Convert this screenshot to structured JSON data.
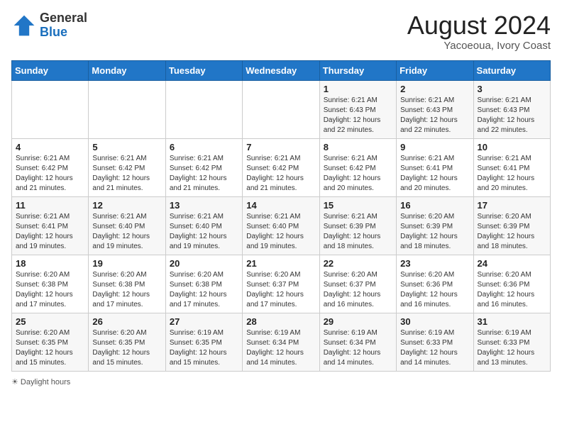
{
  "logo": {
    "general": "General",
    "blue": "Blue"
  },
  "title": {
    "month_year": "August 2024",
    "location": "Yacoeoua, Ivory Coast"
  },
  "days_of_week": [
    "Sunday",
    "Monday",
    "Tuesday",
    "Wednesday",
    "Thursday",
    "Friday",
    "Saturday"
  ],
  "legend": {
    "label": "Daylight hours"
  },
  "weeks": [
    [
      {
        "day": "",
        "info": ""
      },
      {
        "day": "",
        "info": ""
      },
      {
        "day": "",
        "info": ""
      },
      {
        "day": "",
        "info": ""
      },
      {
        "day": "1",
        "info": "Sunrise: 6:21 AM\nSunset: 6:43 PM\nDaylight: 12 hours\nand 22 minutes."
      },
      {
        "day": "2",
        "info": "Sunrise: 6:21 AM\nSunset: 6:43 PM\nDaylight: 12 hours\nand 22 minutes."
      },
      {
        "day": "3",
        "info": "Sunrise: 6:21 AM\nSunset: 6:43 PM\nDaylight: 12 hours\nand 22 minutes."
      }
    ],
    [
      {
        "day": "4",
        "info": "Sunrise: 6:21 AM\nSunset: 6:42 PM\nDaylight: 12 hours\nand 21 minutes."
      },
      {
        "day": "5",
        "info": "Sunrise: 6:21 AM\nSunset: 6:42 PM\nDaylight: 12 hours\nand 21 minutes."
      },
      {
        "day": "6",
        "info": "Sunrise: 6:21 AM\nSunset: 6:42 PM\nDaylight: 12 hours\nand 21 minutes."
      },
      {
        "day": "7",
        "info": "Sunrise: 6:21 AM\nSunset: 6:42 PM\nDaylight: 12 hours\nand 21 minutes."
      },
      {
        "day": "8",
        "info": "Sunrise: 6:21 AM\nSunset: 6:42 PM\nDaylight: 12 hours\nand 20 minutes."
      },
      {
        "day": "9",
        "info": "Sunrise: 6:21 AM\nSunset: 6:41 PM\nDaylight: 12 hours\nand 20 minutes."
      },
      {
        "day": "10",
        "info": "Sunrise: 6:21 AM\nSunset: 6:41 PM\nDaylight: 12 hours\nand 20 minutes."
      }
    ],
    [
      {
        "day": "11",
        "info": "Sunrise: 6:21 AM\nSunset: 6:41 PM\nDaylight: 12 hours\nand 19 minutes."
      },
      {
        "day": "12",
        "info": "Sunrise: 6:21 AM\nSunset: 6:40 PM\nDaylight: 12 hours\nand 19 minutes."
      },
      {
        "day": "13",
        "info": "Sunrise: 6:21 AM\nSunset: 6:40 PM\nDaylight: 12 hours\nand 19 minutes."
      },
      {
        "day": "14",
        "info": "Sunrise: 6:21 AM\nSunset: 6:40 PM\nDaylight: 12 hours\nand 19 minutes."
      },
      {
        "day": "15",
        "info": "Sunrise: 6:21 AM\nSunset: 6:39 PM\nDaylight: 12 hours\nand 18 minutes."
      },
      {
        "day": "16",
        "info": "Sunrise: 6:20 AM\nSunset: 6:39 PM\nDaylight: 12 hours\nand 18 minutes."
      },
      {
        "day": "17",
        "info": "Sunrise: 6:20 AM\nSunset: 6:39 PM\nDaylight: 12 hours\nand 18 minutes."
      }
    ],
    [
      {
        "day": "18",
        "info": "Sunrise: 6:20 AM\nSunset: 6:38 PM\nDaylight: 12 hours\nand 17 minutes."
      },
      {
        "day": "19",
        "info": "Sunrise: 6:20 AM\nSunset: 6:38 PM\nDaylight: 12 hours\nand 17 minutes."
      },
      {
        "day": "20",
        "info": "Sunrise: 6:20 AM\nSunset: 6:38 PM\nDaylight: 12 hours\nand 17 minutes."
      },
      {
        "day": "21",
        "info": "Sunrise: 6:20 AM\nSunset: 6:37 PM\nDaylight: 12 hours\nand 17 minutes."
      },
      {
        "day": "22",
        "info": "Sunrise: 6:20 AM\nSunset: 6:37 PM\nDaylight: 12 hours\nand 16 minutes."
      },
      {
        "day": "23",
        "info": "Sunrise: 6:20 AM\nSunset: 6:36 PM\nDaylight: 12 hours\nand 16 minutes."
      },
      {
        "day": "24",
        "info": "Sunrise: 6:20 AM\nSunset: 6:36 PM\nDaylight: 12 hours\nand 16 minutes."
      }
    ],
    [
      {
        "day": "25",
        "info": "Sunrise: 6:20 AM\nSunset: 6:35 PM\nDaylight: 12 hours\nand 15 minutes."
      },
      {
        "day": "26",
        "info": "Sunrise: 6:20 AM\nSunset: 6:35 PM\nDaylight: 12 hours\nand 15 minutes."
      },
      {
        "day": "27",
        "info": "Sunrise: 6:19 AM\nSunset: 6:35 PM\nDaylight: 12 hours\nand 15 minutes."
      },
      {
        "day": "28",
        "info": "Sunrise: 6:19 AM\nSunset: 6:34 PM\nDaylight: 12 hours\nand 14 minutes."
      },
      {
        "day": "29",
        "info": "Sunrise: 6:19 AM\nSunset: 6:34 PM\nDaylight: 12 hours\nand 14 minutes."
      },
      {
        "day": "30",
        "info": "Sunrise: 6:19 AM\nSunset: 6:33 PM\nDaylight: 12 hours\nand 14 minutes."
      },
      {
        "day": "31",
        "info": "Sunrise: 6:19 AM\nSunset: 6:33 PM\nDaylight: 12 hours\nand 13 minutes."
      }
    ]
  ]
}
